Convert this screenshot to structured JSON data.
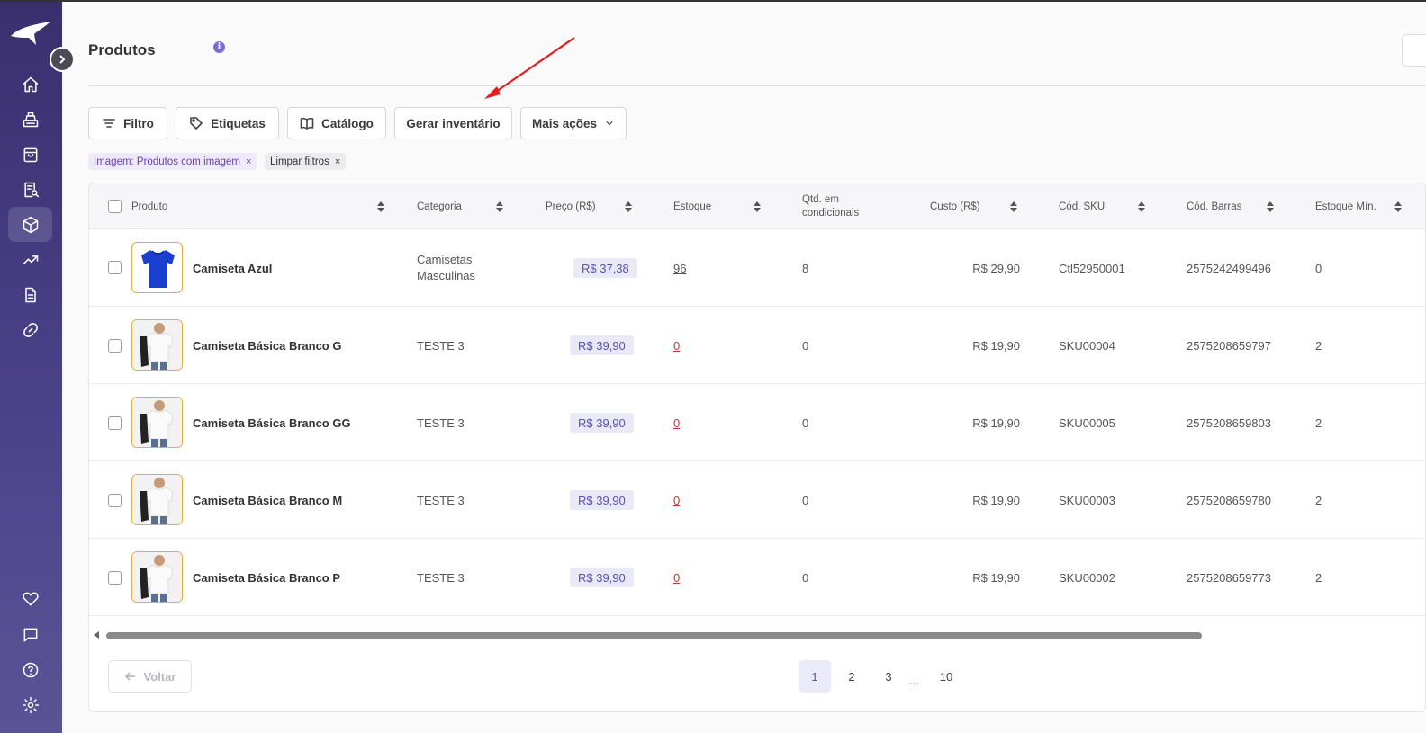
{
  "page": {
    "title": "Produtos"
  },
  "toolbar": {
    "filter": "Filtro",
    "tags": "Etiquetas",
    "catalog": "Catálogo",
    "inventory": "Gerar inventário",
    "more": "Mais ações"
  },
  "chips": {
    "image_filter": "Imagem: Produtos com imagem",
    "clear": "Limpar filtros",
    "remove": "×"
  },
  "table": {
    "headers": {
      "product": "Produto",
      "category": "Categoria",
      "price": "Preço (R$)",
      "stock": "Estoque",
      "qty_line1": "Qtd. em",
      "qty_line2": "condicionais",
      "cost": "Custo (R$)",
      "sku": "Cód. SKU",
      "barcode": "Cód. Barras",
      "min_stock": "Estoque Mín."
    },
    "rows": [
      {
        "name": "Camiseta Azul",
        "category_line1": "Camisetas",
        "category_line2": "Masculinas",
        "price": "R$ 37,38",
        "stock": "96",
        "qty": "8",
        "cost": "R$ 29,90",
        "sku": "Ctl52950001",
        "barcode": "2575242499496",
        "min": "0",
        "image": "blue-tshirt"
      },
      {
        "name": "Camiseta Básica Branco G",
        "category_line1": "TESTE 3",
        "category_line2": "",
        "price": "R$ 39,90",
        "stock": "0",
        "qty": "0",
        "cost": "R$ 19,90",
        "sku": "SKU00004",
        "barcode": "2575208659797",
        "min": "2",
        "image": "white-tshirt-model"
      },
      {
        "name": "Camiseta Básica Branco GG",
        "category_line1": "TESTE 3",
        "category_line2": "",
        "price": "R$ 39,90",
        "stock": "0",
        "qty": "0",
        "cost": "R$ 19,90",
        "sku": "SKU00005",
        "barcode": "2575208659803",
        "min": "2",
        "image": "white-tshirt-model"
      },
      {
        "name": "Camiseta Básica Branco M",
        "category_line1": "TESTE 3",
        "category_line2": "",
        "price": "R$ 39,90",
        "stock": "0",
        "qty": "0",
        "cost": "R$ 19,90",
        "sku": "SKU00003",
        "barcode": "2575208659780",
        "min": "2",
        "image": "white-tshirt-model"
      },
      {
        "name": "Camiseta Básica Branco P",
        "category_line1": "TESTE 3",
        "category_line2": "",
        "price": "R$ 39,90",
        "stock": "0",
        "qty": "0",
        "cost": "R$ 19,90",
        "sku": "SKU00002",
        "barcode": "2575208659773",
        "min": "2",
        "image": "white-tshirt-model"
      }
    ]
  },
  "pagination": {
    "back": "Voltar",
    "pages": [
      "1",
      "2",
      "3",
      "10"
    ],
    "ellipsis": "...",
    "current": "1"
  },
  "colors": {
    "sidebar": "#3a2f6e",
    "accent": "#5a52b8",
    "stock_zero": "#c0392b",
    "annotation_arrow": "#e02020"
  },
  "icons": {
    "sidebar": [
      "home-icon",
      "cash-register-icon",
      "shopping-bag-icon",
      "receipt-search-icon",
      "box-icon",
      "trending-up-icon",
      "document-icon",
      "link-icon",
      "heart-icon",
      "chat-icon",
      "help-icon",
      "settings-icon"
    ]
  }
}
